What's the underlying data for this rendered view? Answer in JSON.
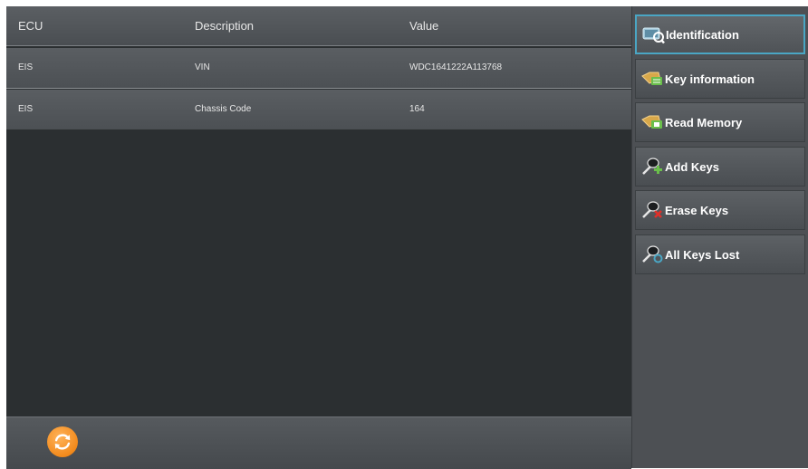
{
  "table": {
    "headers": {
      "ecu": "ECU",
      "description": "Description",
      "value": "Value"
    },
    "rows": [
      {
        "ecu": "EIS",
        "description": "VIN",
        "value": "WDC1641222A113768"
      },
      {
        "ecu": "EIS",
        "description": "Chassis Code",
        "value": "164"
      }
    ]
  },
  "footer": {
    "refresh_icon": "refresh-icon"
  },
  "menu": {
    "items": [
      {
        "label": "Identification",
        "icon": "identification-icon",
        "active": true
      },
      {
        "label": "Key information",
        "icon": "key-information-icon",
        "active": false
      },
      {
        "label": "Read Memory",
        "icon": "read-memory-icon",
        "active": false
      },
      {
        "label": "Add Keys",
        "icon": "add-key-icon",
        "active": false
      },
      {
        "label": "Erase Keys",
        "icon": "erase-key-icon",
        "active": false
      },
      {
        "label": "All Keys Lost",
        "icon": "all-keys-lost-icon",
        "active": false
      }
    ]
  },
  "colors": {
    "accent": "#4aa6c4",
    "refresh": "#f28a1c",
    "background": "#2b2f31"
  }
}
